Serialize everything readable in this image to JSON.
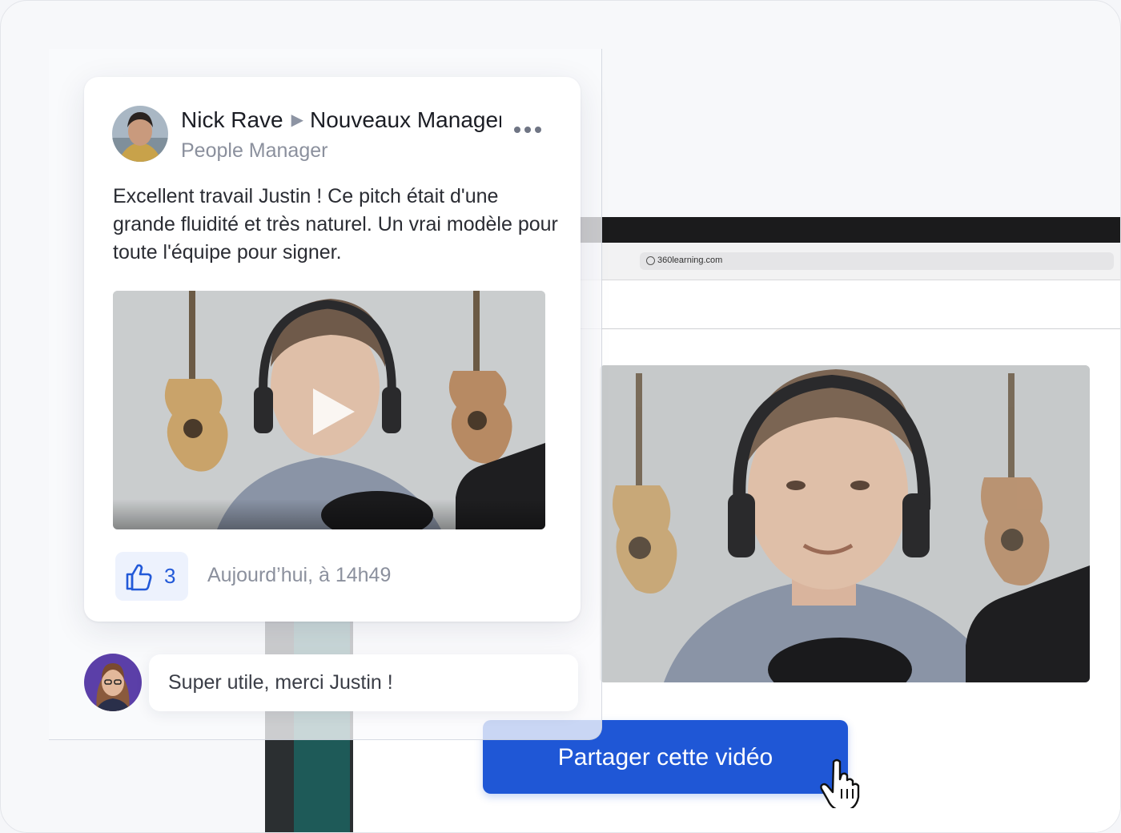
{
  "post": {
    "author_name": "Nick Rave",
    "group_name": "Nouveaux Managers",
    "author_role": "People Manager",
    "text": "Excellent travail Justin ! Ce pitch était d'une grande fluidité et très naturel. Un vrai modèle pour toute l'équipe pour signer.",
    "like_count": "3",
    "timestamp": "Aujourd’hui, à 14h49"
  },
  "comment": {
    "text": "Super utile, merci Justin !"
  },
  "browser": {
    "url": "360learning.com"
  },
  "share_button": {
    "label": "Partager cette vidéo"
  },
  "colors": {
    "accent": "#1f57d6",
    "like_bg": "#edf2fd",
    "like_text": "#2259d8",
    "muted_text": "#8b909d"
  },
  "icons": [
    "play-icon",
    "thumbs-up-icon",
    "more-options-icon",
    "globe-icon",
    "hand-cursor-icon"
  ]
}
